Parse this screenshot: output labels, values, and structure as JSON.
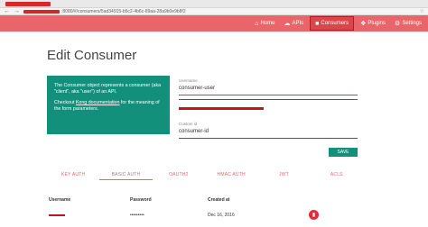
{
  "browser": {
    "back_icon": "arrow-left-icon",
    "forward_icon": "arrow-right-icon",
    "url_text": ":8080/#/consumers/5ad34915-b5c2-4b6c-89aa-28a9b0e9b8f2",
    "bookmark_icon": "star-icon"
  },
  "nav": {
    "items": [
      {
        "label": "Home",
        "icon": "home-icon"
      },
      {
        "label": "APIs",
        "icon": "cloud-icon"
      },
      {
        "label": "Consumers",
        "icon": "person-icon"
      },
      {
        "label": "Plugins",
        "icon": "puzzle-icon"
      },
      {
        "label": "Settings",
        "icon": "gear-icon"
      }
    ],
    "active": "Consumers"
  },
  "page": {
    "title": "Edit Consumer"
  },
  "info": {
    "paragraph1": "The Consumer object represents a consumer (aka \"client\", aka \"user\") of an API.",
    "paragraph2_pre": "Checkout ",
    "paragraph2_link": "Kong documentation",
    "paragraph2_post": " for the meaning of the form parameters."
  },
  "form": {
    "username_label": "Username",
    "username_value": "consumer-user",
    "custom_id_label": "Custom id",
    "custom_id_value": "consumer-id",
    "save_label": "SAVE"
  },
  "tabs": [
    "KEY AUTH",
    "BASIC AUTH",
    "OAUTH2",
    "HMAC AUTH",
    "JWT",
    "ACLS"
  ],
  "active_tab": "BASIC AUTH",
  "table": {
    "headers": [
      "Username",
      "Password",
      "Created at"
    ],
    "rows": [
      {
        "username": "",
        "password": "•••••••••",
        "created_at": "Dec 16, 2016"
      }
    ]
  },
  "colors": {
    "header": "#e8666a",
    "teal": "#13907b",
    "highlight": "#c4141e",
    "delete": "#e8293a"
  }
}
